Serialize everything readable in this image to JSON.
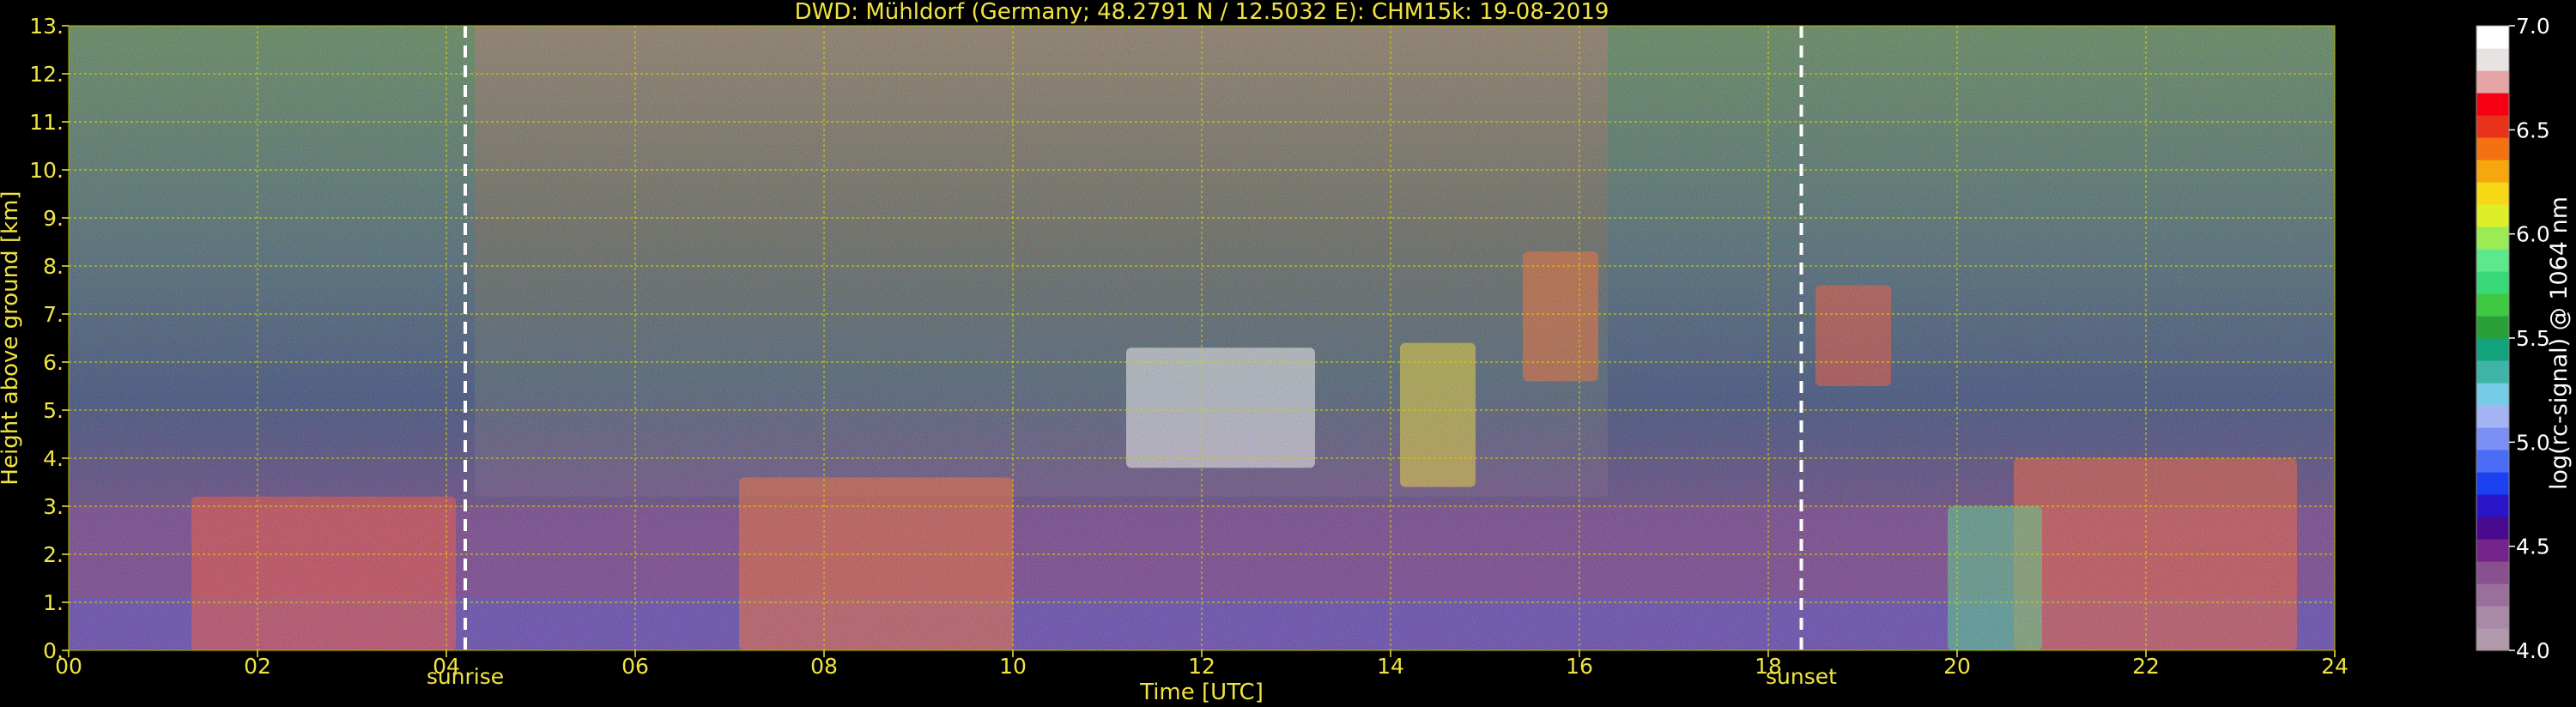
{
  "chart_data": {
    "type": "heatmap",
    "title": "DWD: Mühldorf (Germany; 48.2791 N / 12.5032 E):    CHM15k: 19-08-2019",
    "xlabel": "Time [UTC]",
    "ylabel": "Height above ground [km]",
    "xlim": [
      0,
      24
    ],
    "ylim": [
      0,
      13
    ],
    "x_ticks": [
      0,
      2,
      4,
      6,
      8,
      10,
      12,
      14,
      16,
      18,
      20,
      22,
      24
    ],
    "x_tick_labels": [
      "00",
      "02",
      "04",
      "06",
      "08",
      "10",
      "12",
      "14",
      "16",
      "18",
      "20",
      "22",
      "24"
    ],
    "y_ticks": [
      0,
      1,
      2,
      3,
      4,
      5,
      6,
      7,
      8,
      9,
      10,
      11,
      12,
      13
    ],
    "y_tick_labels": [
      "0.",
      "1.",
      "2.",
      "3.",
      "4.",
      "5.",
      "6.",
      "7.",
      "8.",
      "9.",
      "10.",
      "11.",
      "12.",
      "13."
    ],
    "grid": true,
    "events": [
      {
        "label": "sunrise",
        "time": 4.2
      },
      {
        "label": "sunset",
        "time": 18.35
      }
    ],
    "colorbar": {
      "label": "log(rc-signal) @ 1064 nm",
      "range": [
        4.0,
        7.0
      ],
      "ticks": [
        4.0,
        4.5,
        5.0,
        5.5,
        6.0,
        6.5,
        7.0
      ],
      "tick_labels": [
        "4.0",
        "4.5",
        "5.0",
        "5.5",
        "6.0",
        "6.5",
        "7.0"
      ],
      "colors": [
        "#b19aab",
        "#a88aa8",
        "#9b6f9c",
        "#8a4f8e",
        "#74248a",
        "#4a0a8f",
        "#2a16c8",
        "#1a40f0",
        "#4a6cf7",
        "#7b8ff5",
        "#a4b4f4",
        "#76cbe6",
        "#3fb5a8",
        "#13a37c",
        "#2aa03a",
        "#3ec941",
        "#39d97a",
        "#5ee88e",
        "#9aeb56",
        "#dcef2a",
        "#f6d816",
        "#f6a70d",
        "#f57010",
        "#e8331a",
        "#f40012",
        "#e6a5a5",
        "#e8e2e2",
        "#ffffff"
      ]
    },
    "colors": {
      "background": "#000000",
      "text": "#f0e442",
      "grid": "#d8d000",
      "event_line": "#ffffff"
    }
  }
}
